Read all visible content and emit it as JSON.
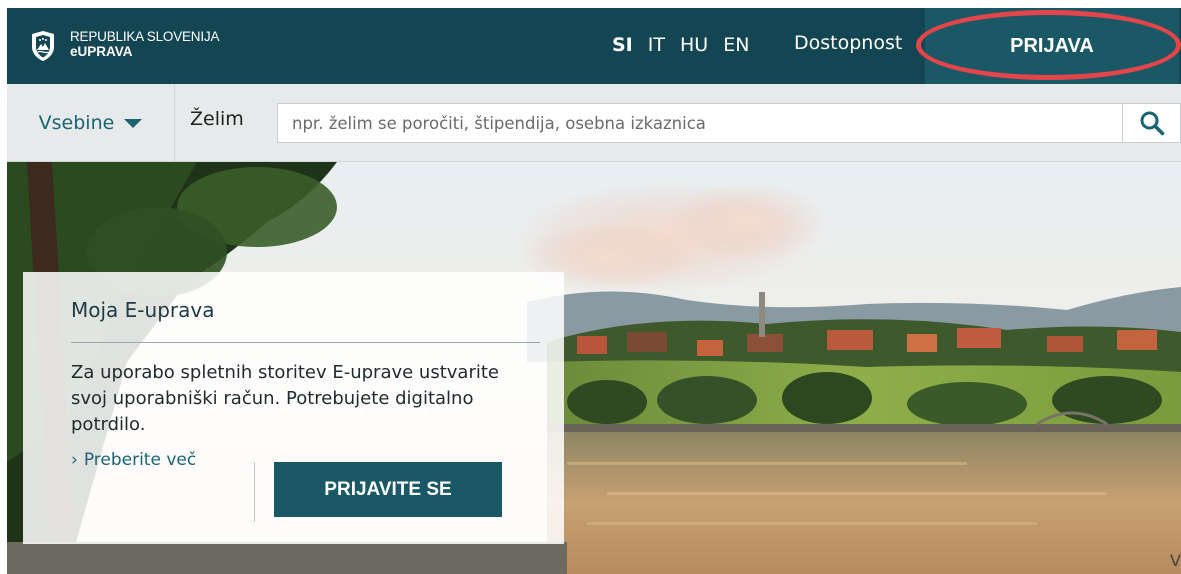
{
  "header": {
    "brand_line1": "REPUBLIKA SLOVENIJA",
    "brand_line2": "eUPRAVA",
    "languages": [
      {
        "code": "SI",
        "active": true
      },
      {
        "code": "IT",
        "active": false
      },
      {
        "code": "HU",
        "active": false
      },
      {
        "code": "EN",
        "active": false
      }
    ],
    "accessibility_label": "Dostopnost",
    "login_label": "PRIJAVA"
  },
  "search": {
    "menu_label": "Vsebine",
    "prefix_label": "Želim",
    "placeholder": "npr. želim se poročiti, štipendija, osebna izkaznica",
    "value": ""
  },
  "card": {
    "title": "Moja E-uprava",
    "text": "Za uporabo spletnih storitev E-uprave ustvarite svoj uporabniški račun. Potrebujete digitalno potrdilo.",
    "more_link": "Preberite več",
    "more_chevron": "›",
    "signin_label": "PRIJAVITE SE"
  },
  "colors": {
    "header_bg": "#134652",
    "button_bg": "#1a5866",
    "link": "#1b6473",
    "highlight": "#e4454a"
  },
  "icons": [
    "crest-icon",
    "chevron-down-icon",
    "search-icon",
    "chevron-right-icon"
  ],
  "corner_text": "V"
}
